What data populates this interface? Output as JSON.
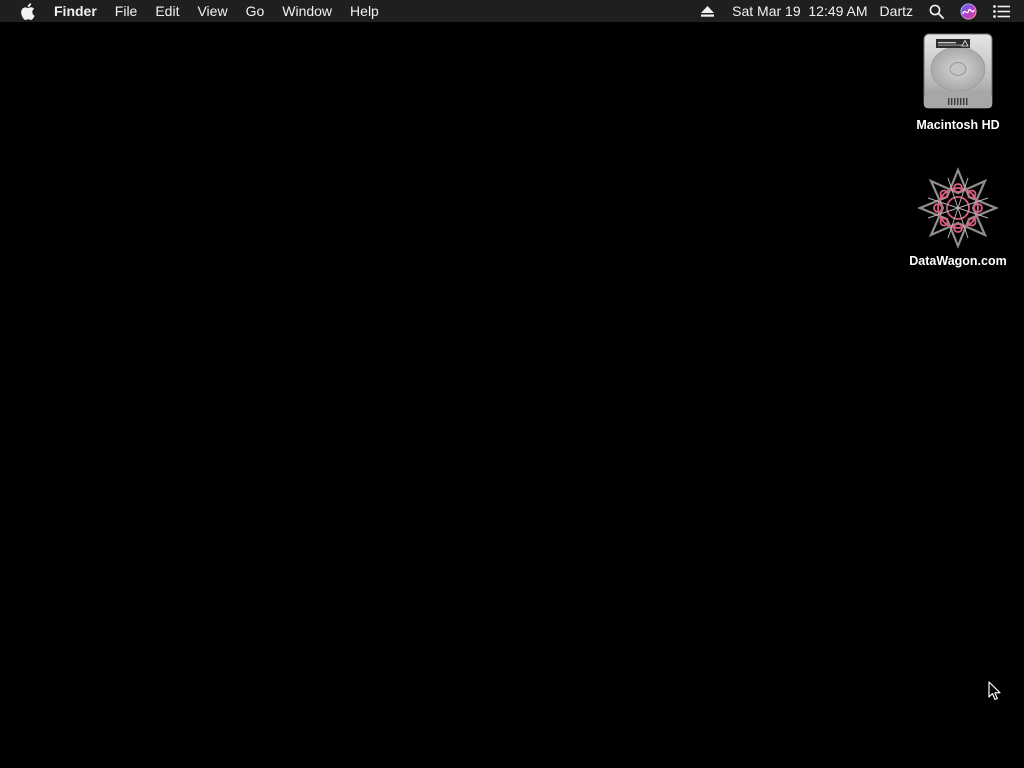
{
  "menubar": {
    "app_name": "Finder",
    "menus": [
      "File",
      "Edit",
      "View",
      "Go",
      "Window",
      "Help"
    ],
    "clock": "Sat Mar 19  12:49 AM",
    "user": "Dartz",
    "status_icons": [
      "eject-icon",
      "spotlight-search-icon",
      "siri-icon",
      "notification-center-icon"
    ]
  },
  "desktop": {
    "icons": [
      {
        "label": "Macintosh HD",
        "icon": "hard-drive-icon"
      },
      {
        "label": "DataWagon.com",
        "icon": "network-volume-icon"
      }
    ]
  },
  "colors": {
    "desktop_bg": "#000000",
    "menubar_bg": "#1f1f1f",
    "accent_pink": "#d9607e"
  }
}
